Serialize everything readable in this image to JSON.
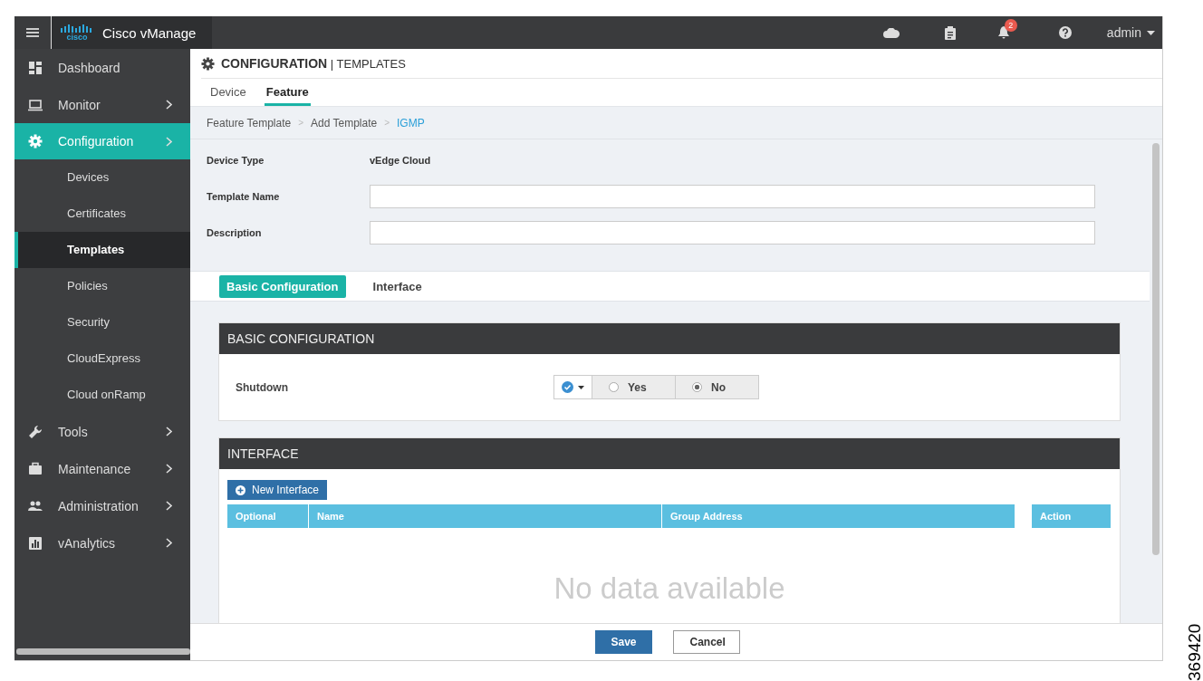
{
  "topbar": {
    "product": "Cisco vManage",
    "logo_text": "cisco",
    "notification_count": "2",
    "user": "admin"
  },
  "sidebar": {
    "items": [
      {
        "label": "Dashboard",
        "submenu": false,
        "selected": false
      },
      {
        "label": "Monitor",
        "submenu": true,
        "selected": false
      },
      {
        "label": "Configuration",
        "submenu": true,
        "selected": true,
        "children": [
          {
            "label": "Devices",
            "selected": false
          },
          {
            "label": "Certificates",
            "selected": false
          },
          {
            "label": "Templates",
            "selected": true
          },
          {
            "label": "Policies",
            "selected": false
          },
          {
            "label": "Security",
            "selected": false
          },
          {
            "label": "CloudExpress",
            "selected": false
          },
          {
            "label": "Cloud onRamp",
            "selected": false
          }
        ]
      },
      {
        "label": "Tools",
        "submenu": true,
        "selected": false
      },
      {
        "label": "Maintenance",
        "submenu": true,
        "selected": false
      },
      {
        "label": "Administration",
        "submenu": true,
        "selected": false
      },
      {
        "label": "vAnalytics",
        "submenu": true,
        "selected": false
      }
    ]
  },
  "header": {
    "title": "CONFIGURATION",
    "subtitle": "TEMPLATES",
    "separator": "|"
  },
  "tabs": [
    {
      "label": "Device",
      "selected": false
    },
    {
      "label": "Feature",
      "selected": true
    }
  ],
  "breadcrumb": [
    {
      "label": "Feature Template",
      "current": false
    },
    {
      "label": "Add Template",
      "current": false
    },
    {
      "label": "IGMP",
      "current": true
    }
  ],
  "breadcrumb_separator": ">",
  "form": {
    "device_type_label": "Device Type",
    "device_type": "vEdge Cloud",
    "template_name_label": "Template Name",
    "description_label": "Description"
  },
  "section_tabs": [
    {
      "label": "Basic Configuration",
      "selected": true
    },
    {
      "label": "Interface",
      "selected": false
    }
  ],
  "basic_configuration": {
    "title": "BASIC CONFIGURATION",
    "shutdown_label": "Shutdown",
    "options": [
      {
        "label": "Yes",
        "selected": false
      },
      {
        "label": "No",
        "selected": true
      }
    ]
  },
  "interface": {
    "title": "INTERFACE",
    "new_button": "New Interface",
    "columns": [
      "Optional",
      "Name",
      "Group Address",
      "Action"
    ],
    "empty_text": "No data available"
  },
  "footer": {
    "buttons": [
      {
        "label": "Save",
        "kind": "primary"
      },
      {
        "label": "Cancel",
        "kind": "secondary"
      }
    ]
  },
  "figure_id": "369420"
}
